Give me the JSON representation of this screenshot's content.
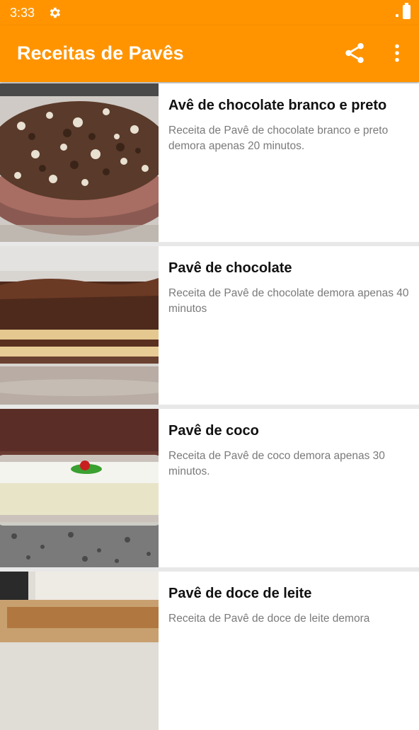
{
  "status": {
    "time": "3:33"
  },
  "appbar": {
    "title": "Receitas de Pavês"
  },
  "colors": {
    "primary": "#ff9400"
  },
  "icons": {
    "share": "share-icon",
    "overflow": "more-vert-icon",
    "settings": "gear-icon"
  },
  "recipes": [
    {
      "title": "Avê de chocolate branco e preto",
      "description": "Receita de Pavê de chocolate branco e preto demora apenas 20 minutos."
    },
    {
      "title": "Pavê de chocolate",
      "description": "Receita de Pavê de chocolate demora apenas 40 minutos"
    },
    {
      "title": "Pavê de coco",
      "description": "Receita de Pavê de coco demora apenas 30 minutos."
    },
    {
      "title": "Pavê de doce de leite",
      "description": "Receita de Pavê de doce de leite demora"
    }
  ]
}
